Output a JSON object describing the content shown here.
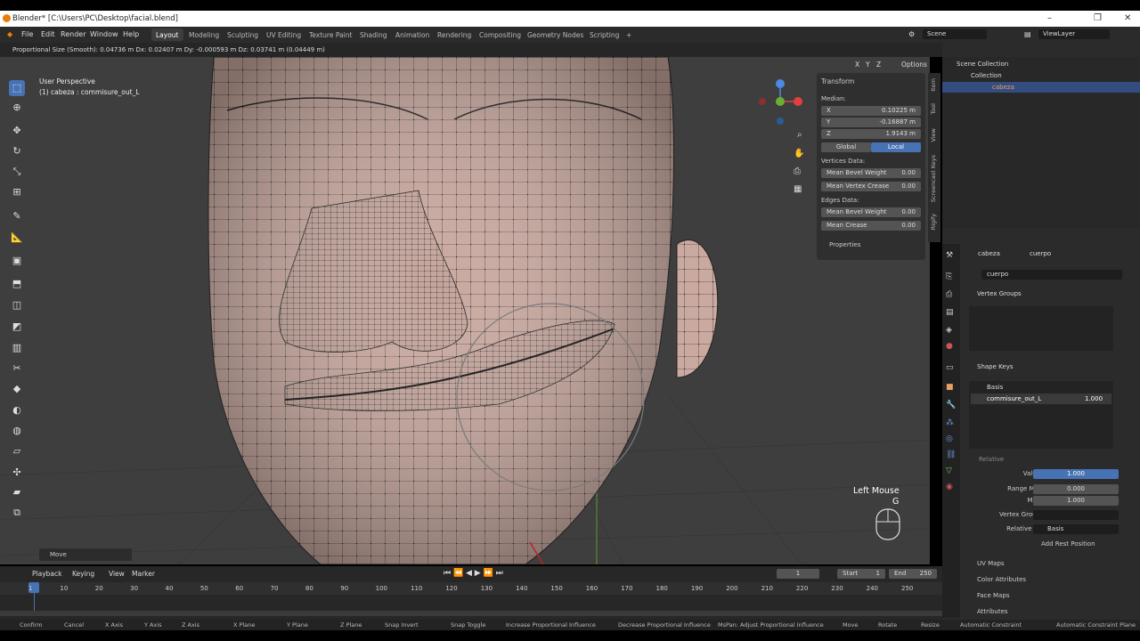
{
  "window": {
    "title": "Blender* [C:\\Users\\PC\\Desktop\\facial.blend]",
    "minimize": "–",
    "maximize": "❐",
    "close": "✕"
  },
  "menu": [
    "File",
    "Edit",
    "Render",
    "Window",
    "Help"
  ],
  "workspaces": [
    "Layout",
    "Modeling",
    "Sculpting",
    "UV Editing",
    "Texture Paint",
    "Shading",
    "Animation",
    "Rendering",
    "Compositing",
    "Geometry Nodes",
    "Scripting",
    "+"
  ],
  "scene": "Scene",
  "view_layer": "ViewLayer",
  "operator_status": "Proportional Size (Smooth): 0.04736 m   Dx: 0.02407 m   Dy: -0.000593 m   Dz: 0.03741 m (0.04449 m)",
  "viewport": {
    "perspective": "User Perspective",
    "object": "(1) cabeza : commisure_out_L",
    "overlay_axes": [
      "X",
      "Y",
      "Z"
    ],
    "options": "Options",
    "last_op": "Move",
    "key_hint": "Left Mouse",
    "key_hint2": "G"
  },
  "transform": {
    "title": "Transform",
    "median": "Median:",
    "x_label": "X",
    "x": "0.10225 m",
    "y_label": "Y",
    "y": "-0.16887 m",
    "z_label": "Z",
    "z": "1.9143 m",
    "global": "Global",
    "local": "Local",
    "vertices_data": "Vertices Data:",
    "mean_bevel_weight": "Mean Bevel Weight",
    "mbw_v": "0.00",
    "mean_vertex_crease": "Mean Vertex Crease",
    "mvc_v": "0.00",
    "edges_data": "Edges Data:",
    "mean_bevel_weight2": "Mean Bevel Weight",
    "mbw2_v": "0.00",
    "mean_crease": "Mean Crease",
    "mc_v": "0.00",
    "properties": "Properties"
  },
  "side_tabs": [
    "Item",
    "Tool",
    "View",
    "Screencast Keys",
    "Rigify"
  ],
  "outliner": {
    "scene_collection": "Scene Collection",
    "collection": "Collection",
    "object": "cabeza"
  },
  "properties": {
    "breadcrumb_obj": "cabeza",
    "breadcrumb_mesh": "cuerpo",
    "mesh_name": "cuerpo",
    "vertex_groups": "Vertex Groups",
    "shape_keys": "Shape Keys",
    "key_basis": "Basis",
    "key_commisure": "commisure_out_L",
    "key_commisure_val": "1.000",
    "relative": "Relative",
    "value_label": "Value",
    "value": "1.000",
    "range_min_label": "Range Min",
    "range_min": "0.000",
    "max_label": "Max",
    "max": "1.000",
    "vertex_group_label": "Vertex Group",
    "relative_to_label": "Relative To",
    "relative_to": "Basis",
    "add_rest": "Add Rest Position",
    "uv_maps": "UV Maps",
    "color_attributes": "Color Attributes",
    "face_maps": "Face Maps",
    "attributes": "Attributes"
  },
  "timeline": {
    "menus": [
      "Playback",
      "Keying",
      "View",
      "Marker"
    ],
    "current": "1",
    "start_label": "Start",
    "start": "1",
    "end_label": "End",
    "end": "250",
    "frames": [
      "1",
      "10",
      "20",
      "30",
      "40",
      "50",
      "60",
      "70",
      "80",
      "90",
      "100",
      "110",
      "120",
      "130",
      "140",
      "150",
      "160",
      "170",
      "180",
      "190",
      "200",
      "210",
      "220",
      "230",
      "240",
      "250"
    ]
  },
  "statusbar": [
    "Confirm",
    "Cancel",
    "X Axis",
    "Y Axis",
    "Z Axis",
    "X Plane",
    "Y Plane",
    "Z Plane",
    "Snap Invert",
    "Snap Toggle",
    "Increase Proportional Influence",
    "Decrease Proportional Influence",
    "MsPan: Adjust Proportional Influence",
    "Move",
    "Rotate",
    "Resize",
    "Automatic Constraint",
    "Automatic Constraint Plane"
  ],
  "colors": {
    "accent": "#4772b3",
    "skin": "#c7a79d",
    "background": "#3e3e3e"
  }
}
